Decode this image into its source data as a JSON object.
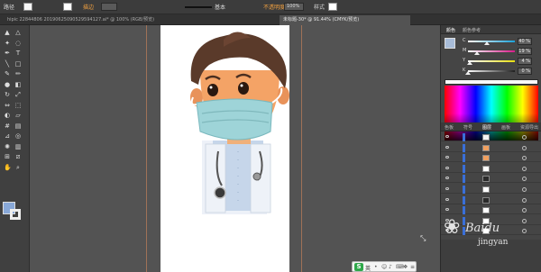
{
  "control_bar": {
    "selection_label": "路径",
    "opacity_label": "描边",
    "stroke_weight": "",
    "style_label": "基本",
    "opacity_field": "不透明度",
    "opacity_value": "100%",
    "style_text": "样式",
    "fill_color": "#f7f7f7",
    "stroke_color": "#ffffff"
  },
  "tabs": [
    {
      "label": "hipic 22844806 20190625090529594127.ai* @ 100% (RGB/预览)",
      "active": false
    },
    {
      "label": "未标题-30* @ 91.44% (CMYK/预览)",
      "active": true
    }
  ],
  "toolbar": {
    "tools": [
      "selection-icon",
      "direct-selection-icon",
      "magic-wand-icon",
      "lasso-icon",
      "pen-icon",
      "type-icon",
      "line-icon",
      "rectangle-icon",
      "paintbrush-icon",
      "pencil-icon",
      "blob-brush-icon",
      "eraser-icon",
      "rotate-icon",
      "scale-icon",
      "width-icon",
      "free-transform-icon",
      "shape-builder-icon",
      "perspective-icon",
      "mesh-icon",
      "gradient-icon",
      "eyedropper-icon",
      "blend-icon",
      "symbol-sprayer-icon",
      "column-graph-icon",
      "artboard-icon",
      "slice-icon",
      "hand-icon",
      "zoom-icon"
    ],
    "fill_color": "#88a8d8",
    "stroke_color": "#ffffff"
  },
  "color_panel": {
    "tabs": [
      "颜色",
      "颜色参考"
    ],
    "channels": [
      {
        "name": "C",
        "value": "40 %",
        "pct": 0.4,
        "track": "#1aa1d8"
      },
      {
        "name": "M",
        "value": "19 %",
        "pct": 0.19,
        "track": "#d81b8a"
      },
      {
        "name": "Y",
        "value": "4 %",
        "pct": 0.04,
        "track": "#e8e010"
      },
      {
        "name": "K",
        "value": "0 %",
        "pct": 0.0,
        "track": "#202020"
      }
    ]
  },
  "layers_panel": {
    "tabs": [
      "色板",
      "符号",
      "图层",
      "画板",
      "资源导出"
    ],
    "rows": [
      {
        "name": "",
        "thumb": "#f4f4f4"
      },
      {
        "name": "",
        "thumb": "#f0a060"
      },
      {
        "name": "",
        "thumb": "#f0a060"
      },
      {
        "name": "",
        "thumb": "#ffffff"
      },
      {
        "name": "",
        "thumb": "#2a2a2a"
      },
      {
        "name": "",
        "thumb": "#ffffff"
      },
      {
        "name": "",
        "thumb": "#2a2a2a"
      },
      {
        "name": "",
        "thumb": "#ffffff"
      },
      {
        "name": "",
        "thumb": "#ffffff"
      },
      {
        "name": "",
        "thumb": "#ffffff"
      }
    ]
  },
  "ime": {
    "logo": "S",
    "label": "英"
  },
  "watermark": {
    "text": "jingyan",
    "brand": "Baidu"
  }
}
